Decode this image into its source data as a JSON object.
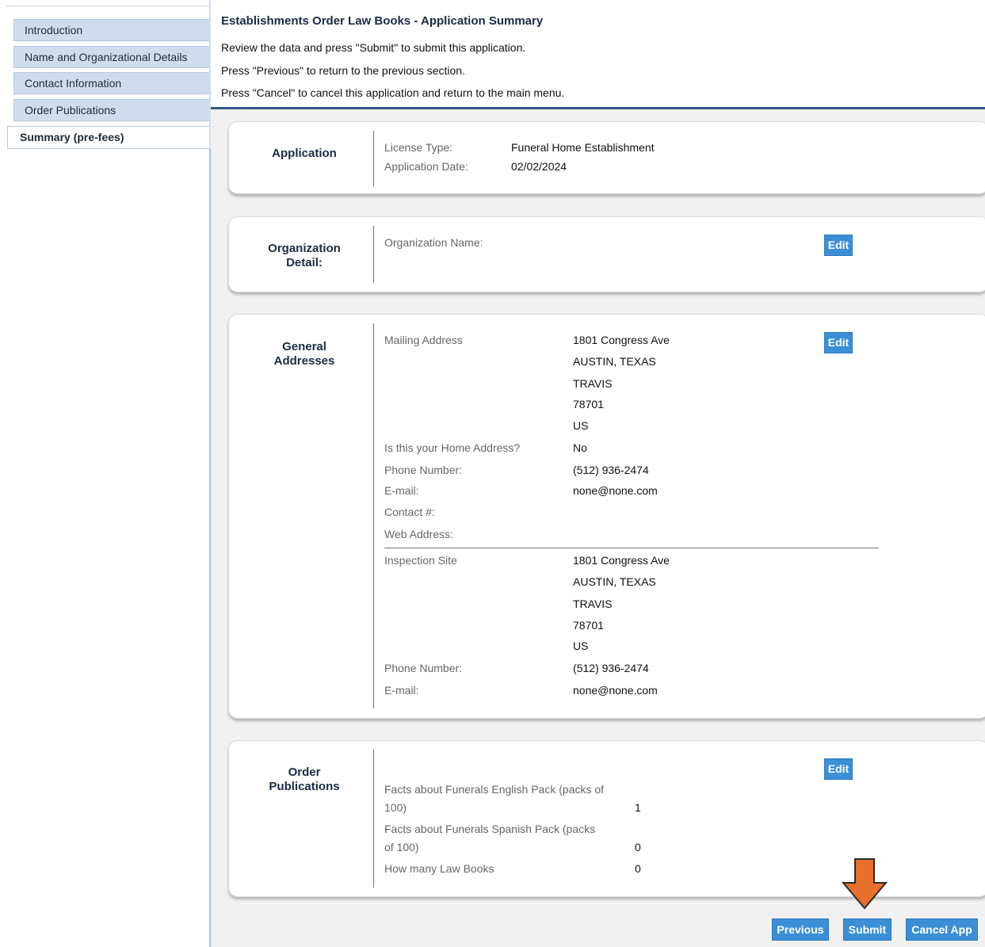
{
  "sidebar": {
    "items": [
      {
        "label": "Introduction"
      },
      {
        "label": "Name and Organizational Details"
      },
      {
        "label": "Contact Information"
      },
      {
        "label": "Order Publications"
      }
    ],
    "active": {
      "label": "Summary (pre-fees)"
    }
  },
  "header": {
    "title": "Establishments Order Law Books - Application Summary",
    "instructions": [
      "Review the data and press \"Submit\" to submit this application.",
      "Press \"Previous\" to return to the previous section.",
      "Press \"Cancel\" to cancel this application and return to the main menu."
    ]
  },
  "application": {
    "title": "Application",
    "license_type_label": "License Type:",
    "license_type_value": "Funeral Home Establishment",
    "date_label": "Application Date:",
    "date_value": "02/02/2024"
  },
  "organization": {
    "title_line1": "Organization",
    "title_line2": "Detail:",
    "name_label": "Organization Name:",
    "name_value": "",
    "edit_label": "Edit"
  },
  "addresses": {
    "title_line1": "General",
    "title_line2": "Addresses",
    "edit_label": "Edit",
    "mailing": {
      "label": "Mailing Address",
      "lines": [
        "1801 Congress Ave",
        "AUSTIN, TEXAS",
        "TRAVIS",
        "78701",
        "US"
      ],
      "home_label": "Is this your Home Address?",
      "home_value": "No",
      "phone_label": "Phone Number:",
      "phone_value": "(512) 936-2474",
      "email_label": "E-mail:",
      "email_value": "none@none.com",
      "contact_label": "Contact #:",
      "web_label": "Web Address:"
    },
    "inspection": {
      "label": "Inspection Site",
      "lines": [
        "1801 Congress Ave",
        "AUSTIN, TEXAS",
        "TRAVIS",
        "78701",
        "US"
      ],
      "phone_label": "Phone Number:",
      "phone_value": "(512) 936-2474",
      "email_label": "E-mail:",
      "email_value": "none@none.com"
    }
  },
  "publications": {
    "title_line1": "Order",
    "title_line2": "Publications",
    "edit_label": "Edit",
    "items": [
      {
        "line1": "Facts about Funerals English Pack (packs of",
        "line2": "100)",
        "qty": "1"
      },
      {
        "line1": "Facts about Funerals Spanish Pack (packs",
        "line2": "of 100)",
        "qty": "0"
      },
      {
        "line1": "How many Law Books",
        "line2": "",
        "qty": "0"
      }
    ]
  },
  "buttons": {
    "previous": "Previous",
    "submit": "Submit",
    "cancel": "Cancel App"
  },
  "colors": {
    "accent": "#3a8fd6",
    "nav_bg": "#cfdcee",
    "header_rule": "#2d5a86",
    "arrow": "#e86f2c"
  },
  "icons": {
    "pointer": "down-arrow-icon"
  }
}
